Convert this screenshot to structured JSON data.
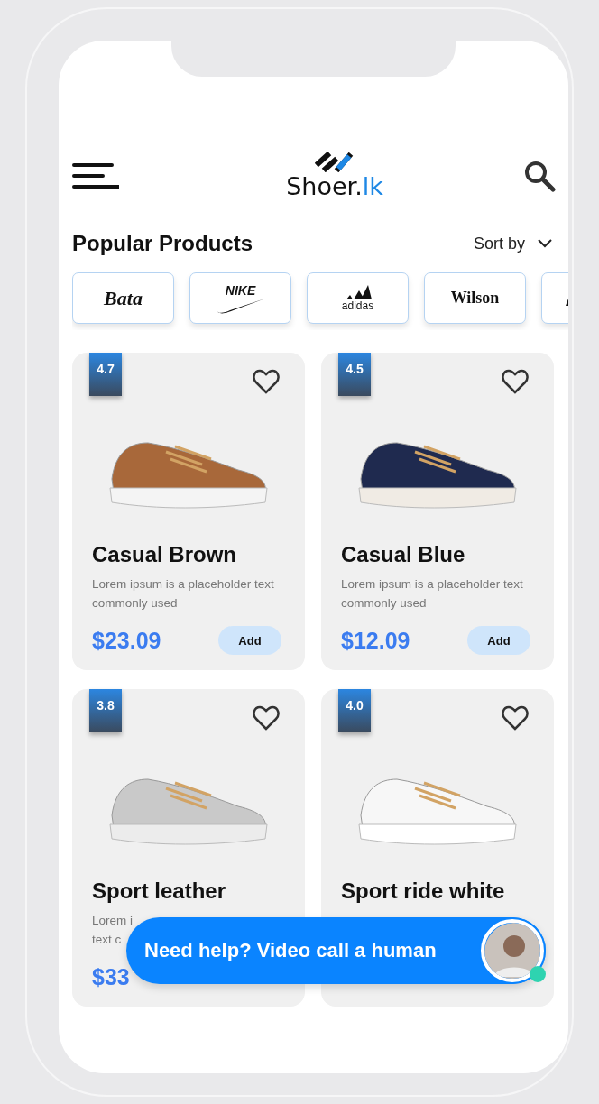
{
  "header": {
    "logo_text": "Shoer.",
    "logo_suffix": "lk"
  },
  "section": {
    "title": "Popular Products",
    "sort_label": "Sort by"
  },
  "brands": [
    {
      "name": "Bata"
    },
    {
      "name": "NIKE"
    },
    {
      "name": "adidas"
    },
    {
      "name": "Wilson"
    }
  ],
  "brands_clipped_tile": true,
  "products": [
    {
      "rating": "4.7",
      "name": "Casual Brown",
      "description": "Lorem ipsum is a placeholder text commonly used",
      "price": "$23.09",
      "add_label": "Add",
      "favorite": false
    },
    {
      "rating": "4.5",
      "name": "Casual Blue",
      "description": "Lorem ipsum is a placeholder text commonly used",
      "price": "$12.09",
      "add_label": "Add",
      "favorite": false
    },
    {
      "rating": "3.8",
      "name": "Sport leather",
      "description": "Lorem i\ntext c",
      "price": "$33",
      "favorite": false
    },
    {
      "rating": "4.0",
      "name": "Sport ride white",
      "favorite": false
    }
  ],
  "help_banner": {
    "text": "Need help? Video call a human",
    "online": true
  }
}
